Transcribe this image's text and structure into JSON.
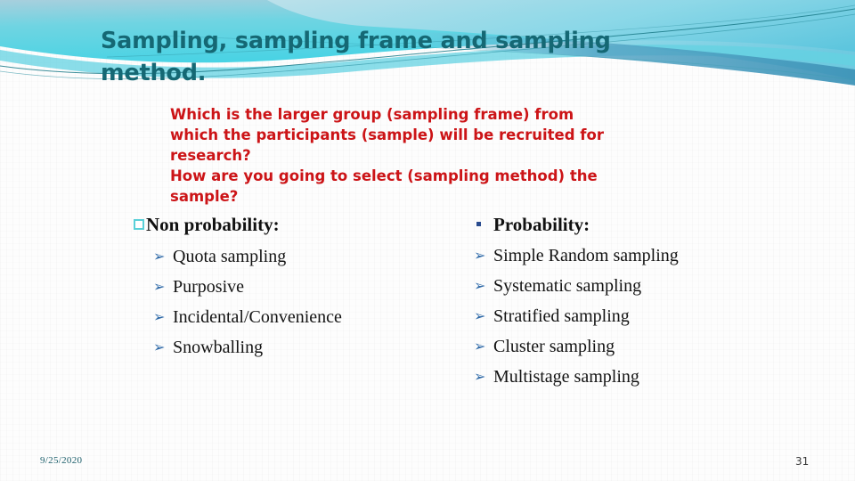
{
  "slide": {
    "title_main": "Sampling, sampling frame and sampling method",
    "title_period": ".",
    "question_lines": [
      "Which is the larger group (sampling frame) from",
      "which the participants (sample) will be recruited for",
      "research?",
      "How are you going to select (sampling method) the",
      "sample?"
    ],
    "left_column": {
      "heading": "Non probability:",
      "bullet_icon": "hollow-square-bullet",
      "items": [
        "Quota sampling",
        "Purposive",
        "Incidental/Convenience",
        "Snowballing"
      ]
    },
    "right_column": {
      "heading": "Probability:",
      "bullet_icon": "small-dot-bullet",
      "items": [
        "Simple Random sampling",
        "Systematic sampling",
        "Stratified sampling",
        "Cluster sampling",
        "Multistage sampling"
      ]
    },
    "arrow_bullet_glyph": "➢",
    "footer": {
      "date": "9/25/2020",
      "page_number": "31"
    },
    "colors": {
      "title": "#156874",
      "question_red": "#cc1417",
      "banner_cyan": "#4fd5e3",
      "banner_steel": "#5aa8c8",
      "banner_line": "#1b7a88",
      "square_bullet_outline": "#59d0d8",
      "arrow_bullet": "#2f6aa8",
      "body_text": "#131313",
      "footer_date": "#1c5f6b",
      "footer_page": "#3a3a3a",
      "background": "#fdfdfd"
    }
  }
}
